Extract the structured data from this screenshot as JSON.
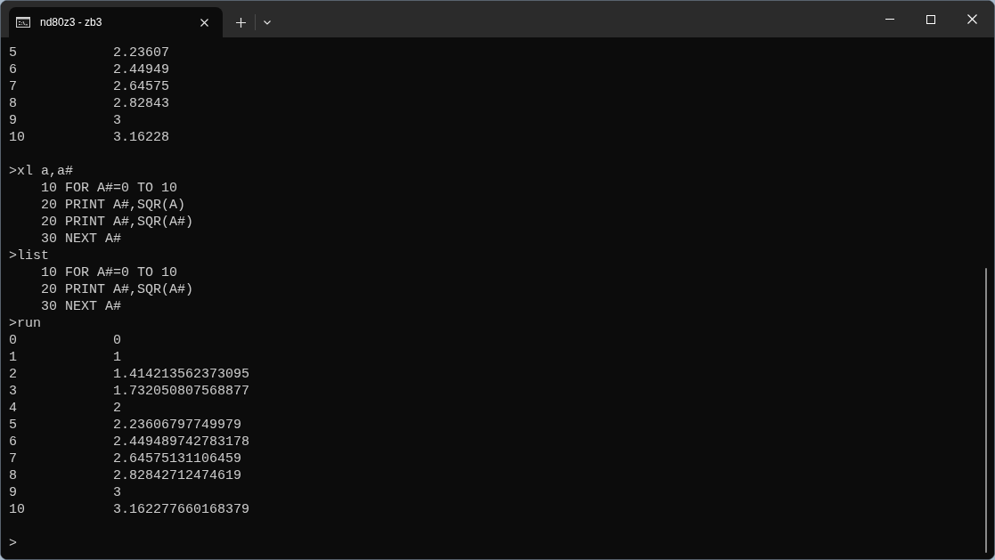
{
  "window": {
    "tabs": [
      {
        "title": "nd80z3 - zb3",
        "selected": true
      }
    ]
  },
  "terminal": {
    "lines": [
      {
        "kind": "row",
        "index": "5",
        "value": "2.23607"
      },
      {
        "kind": "row",
        "index": "6",
        "value": "2.44949"
      },
      {
        "kind": "row",
        "index": "7",
        "value": "2.64575"
      },
      {
        "kind": "row",
        "index": "8",
        "value": "2.82843"
      },
      {
        "kind": "row",
        "index": "9",
        "value": "3"
      },
      {
        "kind": "row",
        "index": "10",
        "value": "3.16228"
      },
      {
        "kind": "blank"
      },
      {
        "kind": "command",
        "text": ">xl a,a#"
      },
      {
        "kind": "listing",
        "text": "10 FOR A#=0 TO 10"
      },
      {
        "kind": "listing",
        "text": "20 PRINT A#,SQR(A)"
      },
      {
        "kind": "listing",
        "text": "20 PRINT A#,SQR(A#)"
      },
      {
        "kind": "listing",
        "text": "30 NEXT A#"
      },
      {
        "kind": "command",
        "text": ">list"
      },
      {
        "kind": "listing",
        "text": "10 FOR A#=0 TO 10"
      },
      {
        "kind": "listing",
        "text": "20 PRINT A#,SQR(A#)"
      },
      {
        "kind": "listing",
        "text": "30 NEXT A#"
      },
      {
        "kind": "command",
        "text": ">run"
      },
      {
        "kind": "row",
        "index": "0",
        "value": "0"
      },
      {
        "kind": "row",
        "index": "1",
        "value": "1"
      },
      {
        "kind": "row",
        "index": "2",
        "value": "1.414213562373095"
      },
      {
        "kind": "row",
        "index": "3",
        "value": "1.732050807568877"
      },
      {
        "kind": "row",
        "index": "4",
        "value": "2"
      },
      {
        "kind": "row",
        "index": "5",
        "value": "2.23606797749979"
      },
      {
        "kind": "row",
        "index": "6",
        "value": "2.449489742783178"
      },
      {
        "kind": "row",
        "index": "7",
        "value": "2.64575131106459"
      },
      {
        "kind": "row",
        "index": "8",
        "value": "2.82842712474619"
      },
      {
        "kind": "row",
        "index": "9",
        "value": "3"
      },
      {
        "kind": "row",
        "index": "10",
        "value": "3.162277660168379"
      },
      {
        "kind": "blank"
      },
      {
        "kind": "command",
        "text": ">"
      }
    ]
  }
}
